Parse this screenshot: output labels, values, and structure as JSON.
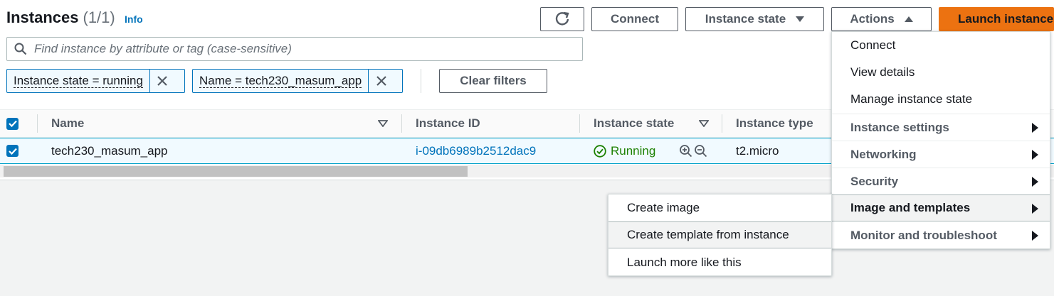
{
  "header": {
    "title": "Instances",
    "count": "(1/1)",
    "info_link": "Info"
  },
  "toolbar": {
    "refresh_icon": "refresh-icon",
    "connect_label": "Connect",
    "instance_state_label": "Instance state",
    "actions_label": "Actions",
    "launch_label": "Launch instances"
  },
  "search": {
    "placeholder": "Find instance by attribute or tag (case-sensitive)",
    "value": ""
  },
  "filters": [
    {
      "label": "Instance state = running"
    },
    {
      "label": "Name = tech230_masum_app"
    }
  ],
  "clear_filters_label": "Clear filters",
  "table": {
    "columns": [
      "Name",
      "Instance ID",
      "Instance state",
      "Instance type"
    ],
    "rows": [
      {
        "name": "tech230_masum_app",
        "instance_id": "i-09db6989b2512dac9",
        "state": "Running",
        "type": "t2.micro",
        "selected": true
      }
    ]
  },
  "actions_menu": {
    "items": [
      {
        "label": "Connect",
        "type": "item"
      },
      {
        "label": "View details",
        "type": "item"
      },
      {
        "label": "Manage instance state",
        "type": "item"
      },
      {
        "label": "Instance settings",
        "type": "group"
      },
      {
        "label": "Networking",
        "type": "group"
      },
      {
        "label": "Security",
        "type": "group"
      },
      {
        "label": "Image and templates",
        "type": "group",
        "active": true
      },
      {
        "label": "Monitor and troubleshoot",
        "type": "group"
      }
    ]
  },
  "image_templates_submenu": {
    "items": [
      {
        "label": "Create image"
      },
      {
        "label": "Create template from instance",
        "hovered": true
      },
      {
        "label": "Launch more like this"
      }
    ]
  },
  "colors": {
    "primary": "#ec7211",
    "link": "#0073bb",
    "success": "#1d8102"
  }
}
